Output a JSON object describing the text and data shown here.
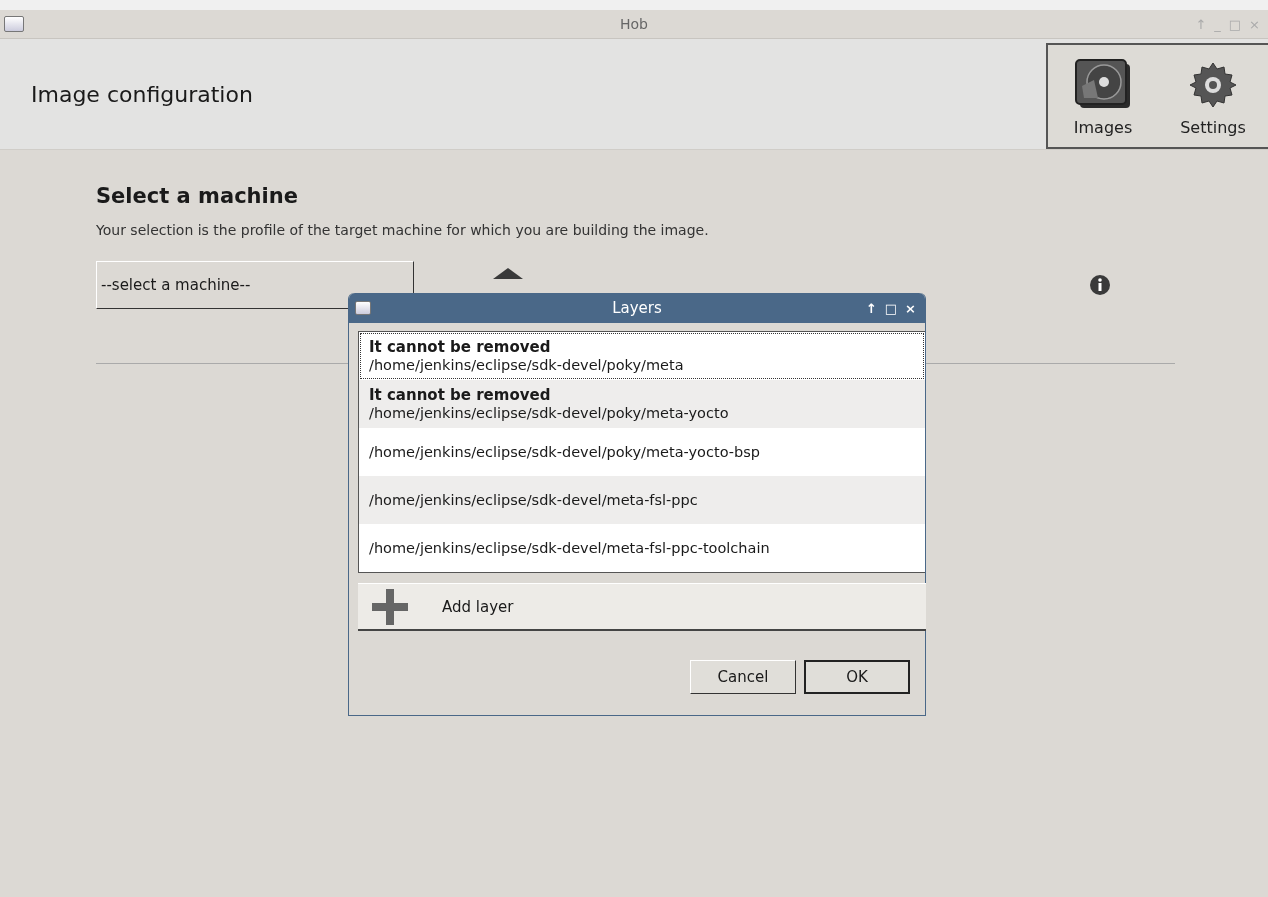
{
  "window": {
    "title": "Hob",
    "controls": [
      "↑",
      "_",
      "□",
      "×"
    ]
  },
  "header": {
    "title": "Image configuration",
    "tools": [
      {
        "kind": "images",
        "label": "Images"
      },
      {
        "kind": "settings",
        "label": "Settings"
      }
    ]
  },
  "machine": {
    "heading": "Select a machine",
    "description": "Your selection is the profile of the target machine for which you are building the image.",
    "combo": "--select a machine--"
  },
  "dialog": {
    "title": "Layers",
    "layers": [
      {
        "note": "It cannot be removed",
        "path": "/home/jenkins/eclipse/sdk-devel/poky/meta",
        "focused": true
      },
      {
        "note": "It cannot be removed",
        "path": "/home/jenkins/eclipse/sdk-devel/poky/meta-yocto",
        "focused": false
      },
      {
        "path": "/home/jenkins/eclipse/sdk-devel/poky/meta-yocto-bsp",
        "focused": false
      },
      {
        "path": "/home/jenkins/eclipse/sdk-devel/meta-fsl-ppc",
        "focused": false
      },
      {
        "path": "/home/jenkins/eclipse/sdk-devel/meta-fsl-ppc-toolchain",
        "focused": false
      }
    ],
    "add": "Add layer",
    "buttons": [
      {
        "label": "Cancel",
        "default": false
      },
      {
        "label": "OK",
        "default": true
      }
    ]
  }
}
